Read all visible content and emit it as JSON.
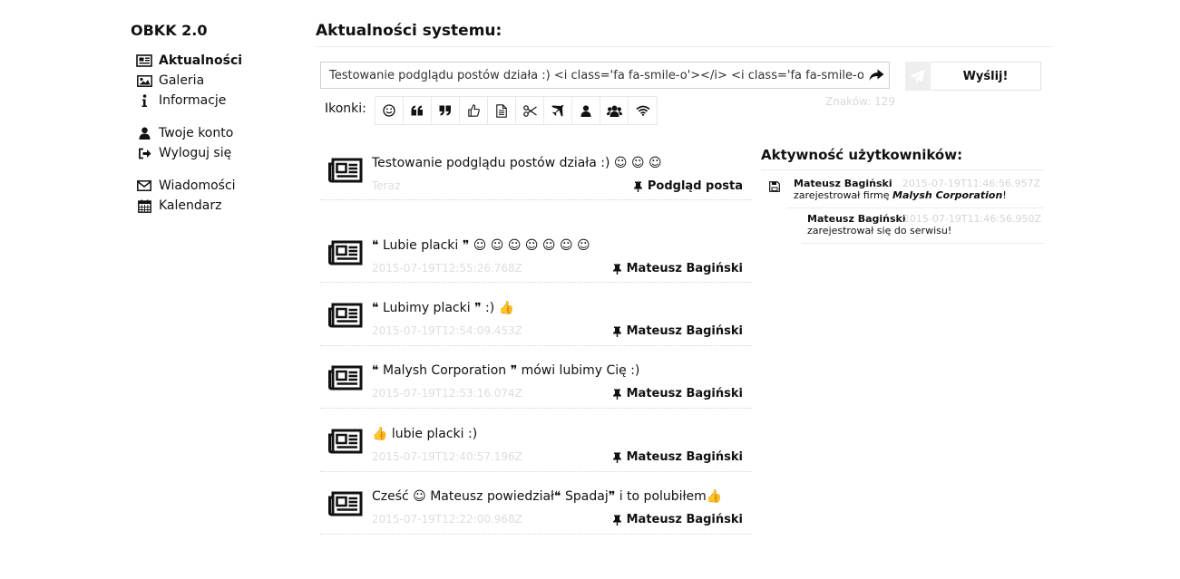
{
  "app": {
    "title": "OBKK 2.0"
  },
  "nav": {
    "groups": [
      [
        {
          "label": "Aktualności",
          "icon": "newspaper-icon",
          "active": true
        },
        {
          "label": "Galeria",
          "icon": "picture-icon"
        },
        {
          "label": "Informacje",
          "icon": "info-icon"
        }
      ],
      [
        {
          "label": "Twoje konto",
          "icon": "user-icon"
        },
        {
          "label": "Wyloguj się",
          "icon": "sign-out-icon"
        }
      ],
      [
        {
          "label": "Wiadomości",
          "icon": "envelope-icon"
        },
        {
          "label": "Kalendarz",
          "icon": "calendar-icon"
        }
      ]
    ]
  },
  "main": {
    "title": "Aktualności systemu:"
  },
  "composer": {
    "value": "Testowanie podglądu postów działa :) <i class='fa fa-smile-o'></i>  <i class='fa fa-smile-o'></i>",
    "send_label": "Wyślij!",
    "counter": "Znaków: 129",
    "icons_label": "Ikonki:",
    "icons": [
      "smile-icon",
      "quote-left-icon",
      "quote-right-icon",
      "thumbs-up-icon",
      "file-text-icon",
      "scissors-icon",
      "plane-icon",
      "user-icon",
      "users-icon",
      "wifi-icon"
    ]
  },
  "posts": [
    {
      "text": "Testowanie podglądu postów działa :) ☺ ☺ ☺",
      "time": "Teraz",
      "author": "Podgląd posta"
    },
    {
      "text": "❝ Lubie placki ❞ ☺ ☺ ☺ ☺ ☺ ☺ ☺",
      "time": "2015-07-19T12:55:26.768Z",
      "author": "Mateusz Bagiński"
    },
    {
      "text": "❝ Lubimy placki ❞ :) 👍",
      "time": "2015-07-19T12:54:09.453Z",
      "author": "Mateusz Bagiński"
    },
    {
      "text": "❝ Malysh Corporation ❞ mówi lubimy Cię :)",
      "time": "2015-07-19T12:53:16.074Z",
      "author": "Mateusz Bagiński"
    },
    {
      "text": "👍 lubie placki :)",
      "time": "2015-07-19T12:40:57.196Z",
      "author": "Mateusz Bagiński"
    },
    {
      "text": "Cześć ☺ Mateusz powiedział❝ Spadaj❞ i to polubiłem👍",
      "time": "2015-07-19T12:22:00.968Z",
      "author": "Mateusz Bagiński"
    }
  ],
  "activity": {
    "title": "Aktywność użytkowników:",
    "items": [
      {
        "who": "Mateusz Bagiński",
        "time": "2015-07-19T11:46:56.957Z",
        "pre": "zarejestrował firmę ",
        "em": "Malysh Corporation",
        "post": "!",
        "icon": "save-icon"
      },
      {
        "who": "Mateusz Bagiński",
        "time": "2015-07-19T11:46:56.950Z",
        "pre": "zarejestrował się do serwisu!",
        "em": "",
        "post": ""
      }
    ]
  },
  "colors": {
    "muted": "#dddddd",
    "border": "#cfcfcf"
  }
}
